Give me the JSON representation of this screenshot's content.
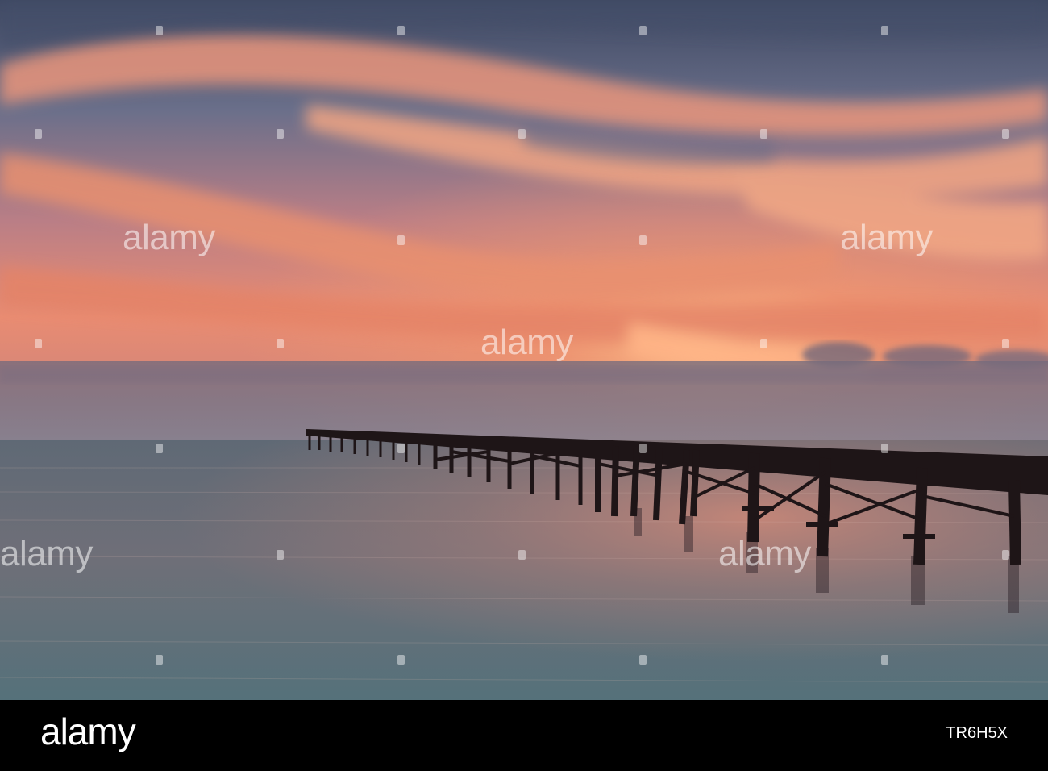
{
  "watermark": {
    "text": "alamy"
  },
  "footer": {
    "brand": "alamy",
    "image_id": "TR6H5X"
  },
  "palette": {
    "sky_top": "#4a5570",
    "sky_glow": "#f08a68",
    "cloud_pink": "#f4a07c",
    "haze": "#7c6e78",
    "sea": "#65707a",
    "pier": "#1c1416"
  }
}
